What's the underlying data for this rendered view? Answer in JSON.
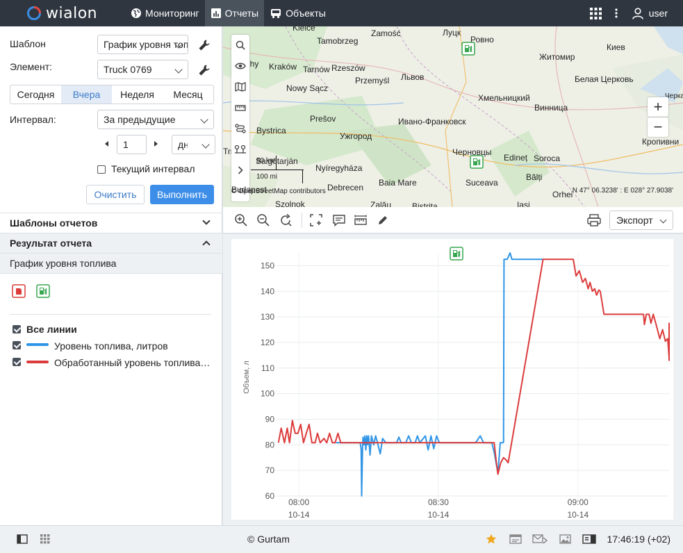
{
  "header": {
    "logo_text": "wialon",
    "nav": [
      {
        "label": "Мониторинг"
      },
      {
        "label": "Отчеты"
      },
      {
        "label": "Объекты"
      }
    ],
    "user": "user"
  },
  "form": {
    "template_label": "Шаблон",
    "template_value": "График уровня топлива",
    "element_label": "Элемент:",
    "element_value": "Truck 0769",
    "tabs": [
      "Сегодня",
      "Вчера",
      "Неделя",
      "Месяц"
    ],
    "active_tab": 1,
    "interval_label": "Интервал:",
    "interval_value": "За предыдущие",
    "count_value": "1",
    "unit_value": "дни",
    "current_interval_label": "Текущий интервал",
    "clear_label": "Очистить",
    "run_label": "Выполнить"
  },
  "sections": {
    "templates_label": "Шаблоны отчетов",
    "result_label": "Результат отчета",
    "result_item": "График уровня топлива"
  },
  "legend": {
    "all_label": "Все линии",
    "items": [
      {
        "label": "Уровень топлива, литров",
        "color": "#2f95e6"
      },
      {
        "label": "Обработанный уровень топлива, литров",
        "color": "#dc3b3b"
      }
    ]
  },
  "map": {
    "cities": [
      {
        "name": "Kielce"
      },
      {
        "name": "Zamość"
      },
      {
        "name": "Луцк"
      },
      {
        "name": "Ровно"
      },
      {
        "name": "Tamobrzeg"
      },
      {
        "name": "Житомир"
      },
      {
        "name": "Киев"
      },
      {
        "name": "Kraków"
      },
      {
        "name": "Tarnów"
      },
      {
        "name": "Rzeszów"
      },
      {
        "name": "Przemyśl"
      },
      {
        "name": "Львов"
      },
      {
        "name": "Nowy Sącz"
      },
      {
        "name": "Белая Церковь"
      },
      {
        "name": "Хмельницкий"
      },
      {
        "name": "Винница"
      },
      {
        "name": "Bystrica"
      },
      {
        "name": "Prešov"
      },
      {
        "name": "Ивано-Франковск"
      },
      {
        "name": "Кропивни"
      },
      {
        "name": "Ужгород"
      },
      {
        "name": "Черновцы"
      },
      {
        "name": "Edineț"
      },
      {
        "name": "Soroca"
      },
      {
        "name": "Salgótarján"
      },
      {
        "name": "Nyíregyháza"
      },
      {
        "name": "Bălți"
      },
      {
        "name": "Debrecen"
      },
      {
        "name": "Baia Mare"
      },
      {
        "name": "Suceava"
      },
      {
        "name": "Orhei"
      },
      {
        "name": "Szolnok"
      },
      {
        "name": "Zalău"
      },
      {
        "name": "Bistrița"
      },
      {
        "name": "Iași"
      },
      {
        "name": "Черкассы"
      },
      {
        "name": "Trna"
      },
      {
        "name": "Chy"
      }
    ],
    "scale_km": "50 km",
    "scale_mi": "100 mi",
    "attribution": "© OpenStreetMap contributors",
    "attrib_city": "Budapest",
    "coords": "N 47° 06.3238' : E 028° 27.9038'"
  },
  "toolbar": {
    "export_label": "Экспорт"
  },
  "chart_data": {
    "type": "line",
    "ylabel": "Объем, л",
    "ylim": [
      57,
      155
    ],
    "yticks": [
      60,
      70,
      80,
      90,
      100,
      110,
      120,
      130,
      140,
      150
    ],
    "xticks": [
      {
        "time": "08:00",
        "date": "10-14",
        "minutes": 480
      },
      {
        "time": "08:30",
        "date": "10-14",
        "minutes": 510
      },
      {
        "time": "09:00",
        "date": "10-14",
        "minutes": 540
      }
    ],
    "xlim": [
      475.2,
      559.6
    ],
    "refuel_marker_minutes": 510,
    "series": [
      {
        "name": "Уровень топлива, литров",
        "color": "#2f95e6",
        "points": [
          [
            488.0,
            80.8
          ],
          [
            490.0,
            80.8
          ],
          [
            492.0,
            80.8
          ],
          [
            493.2,
            80.8
          ],
          [
            493.4,
            78.0
          ],
          [
            493.5,
            60.0
          ],
          [
            493.7,
            79.0
          ],
          [
            493.8,
            83.0
          ],
          [
            494.0,
            80.0
          ],
          [
            494.2,
            83.5
          ],
          [
            494.4,
            78.0
          ],
          [
            494.6,
            83.5
          ],
          [
            494.8,
            80.0
          ],
          [
            495.0,
            83.5
          ],
          [
            495.3,
            76.0
          ],
          [
            495.6,
            83.5
          ],
          [
            496.1,
            80.0
          ],
          [
            496.5,
            83.5
          ],
          [
            496.9,
            80.8
          ],
          [
            497.5,
            76.5
          ],
          [
            498.0,
            82.5
          ],
          [
            498.7,
            80.8
          ],
          [
            500.0,
            80.8
          ],
          [
            501.0,
            80.8
          ],
          [
            501.5,
            83.0
          ],
          [
            502.0,
            80.8
          ],
          [
            503.0,
            80.8
          ],
          [
            503.6,
            83.5
          ],
          [
            504.2,
            80.8
          ],
          [
            505.0,
            80.8
          ],
          [
            505.5,
            83.5
          ],
          [
            506.0,
            80.8
          ],
          [
            507.2,
            83.5
          ],
          [
            507.8,
            78.0
          ],
          [
            508.4,
            83.5
          ],
          [
            509.0,
            78.5
          ],
          [
            509.6,
            83.5
          ],
          [
            510.2,
            80.8
          ],
          [
            514.0,
            80.8
          ],
          [
            516.0,
            80.8
          ],
          [
            518.0,
            80.8
          ],
          [
            519.0,
            83.5
          ],
          [
            519.7,
            80.8
          ],
          [
            521.5,
            80.8
          ],
          [
            522.0,
            77.0
          ],
          [
            522.8,
            69.0
          ],
          [
            523.3,
            80.8
          ],
          [
            523.8,
            80.8
          ],
          [
            524.0,
            81.0
          ],
          [
            524.1,
            152.5
          ],
          [
            524.8,
            152.5
          ],
          [
            525.4,
            155.0
          ],
          [
            525.8,
            152.5
          ],
          [
            532.5,
            152.5
          ]
        ]
      },
      {
        "name": "Обработанный уровень топлива, литров",
        "color": "#dc3b3b",
        "points": [
          [
            475.6,
            80.8
          ],
          [
            476.2,
            86.5
          ],
          [
            476.9,
            80.8
          ],
          [
            477.5,
            86.5
          ],
          [
            478.0,
            80.8
          ],
          [
            478.6,
            89.5
          ],
          [
            479.2,
            84.5
          ],
          [
            479.8,
            84.5
          ],
          [
            480.4,
            88.0
          ],
          [
            481.0,
            80.8
          ],
          [
            481.6,
            84.5
          ],
          [
            482.2,
            88.0
          ],
          [
            482.8,
            80.8
          ],
          [
            483.5,
            80.8
          ],
          [
            484.0,
            84.5
          ],
          [
            484.6,
            80.8
          ],
          [
            485.4,
            82.5
          ],
          [
            486.0,
            80.8
          ],
          [
            486.6,
            84.5
          ],
          [
            487.2,
            80.8
          ],
          [
            487.8,
            80.8
          ],
          [
            488.4,
            84.5
          ],
          [
            489.0,
            80.8
          ],
          [
            492.0,
            80.8
          ],
          [
            500.0,
            80.8
          ],
          [
            508.0,
            80.8
          ],
          [
            516.0,
            80.8
          ],
          [
            522.0,
            80.8
          ],
          [
            522.4,
            74.0
          ],
          [
            522.8,
            68.5
          ],
          [
            523.4,
            73.0
          ],
          [
            524.0,
            75.0
          ],
          [
            524.6,
            74.0
          ],
          [
            525.0,
            73.0
          ],
          [
            532.5,
            152.5
          ],
          [
            539.0,
            152.5
          ],
          [
            539.6,
            146.0
          ],
          [
            540.3,
            148.0
          ],
          [
            541.0,
            143.5
          ],
          [
            541.6,
            145.0
          ],
          [
            542.2,
            141.0
          ],
          [
            542.6,
            143.5
          ],
          [
            543.1,
            140.0
          ],
          [
            543.6,
            141.0
          ],
          [
            544.0,
            138.5
          ],
          [
            544.5,
            140.5
          ],
          [
            544.8,
            140.0
          ],
          [
            545.6,
            131.0
          ],
          [
            548.0,
            131.0
          ],
          [
            552.0,
            131.0
          ],
          [
            554.1,
            131.0
          ],
          [
            554.3,
            127.0
          ],
          [
            554.7,
            131.0
          ],
          [
            555.3,
            131.0
          ],
          [
            555.7,
            127.5
          ],
          [
            556.2,
            131.0
          ],
          [
            556.8,
            127.0
          ],
          [
            557.6,
            121.5
          ],
          [
            558.2,
            125.0
          ],
          [
            558.8,
            120.5
          ],
          [
            559.3,
            121.5
          ],
          [
            560.3,
            114.0
          ],
          [
            561.0,
            119.0
          ],
          [
            562.0,
            121.5
          ],
          [
            563.0,
            124.0
          ],
          [
            563.8,
            120.5
          ],
          [
            564.5,
            116.0
          ],
          [
            565.0,
            121.5
          ],
          [
            565.7,
            121.5
          ],
          [
            566.3,
            115.0
          ],
          [
            566.9,
            117.5
          ],
          [
            567.6,
            113.5
          ],
          [
            568.2,
            119.5
          ],
          [
            569.0,
            122.0
          ],
          [
            569.5,
            127.5
          ],
          [
            569.9,
            121.5
          ],
          [
            570.4,
            118.0
          ],
          [
            571.0,
            117.5
          ],
          [
            571.6,
            118.0
          ],
          [
            572.1,
            113.0
          ],
          [
            572.6,
            120.5
          ],
          [
            573.0,
            117.5
          ]
        ]
      }
    ]
  },
  "footer": {
    "copyright": "© Gurtam",
    "time": "17:46:19 (+02)"
  }
}
